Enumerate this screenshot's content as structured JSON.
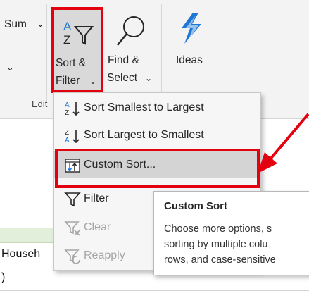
{
  "ribbon": {
    "autosum_label": "Sum",
    "sort_filter": {
      "line1": "Sort &",
      "line2": "Filter"
    },
    "find_select": {
      "line1": "Find &",
      "line2": "Select"
    },
    "ideas_label": "Ideas",
    "group_label": "Edit"
  },
  "sheet": {
    "cell_text": "Househ",
    "cell_text_2": ")",
    "header_fill": "#e2efda"
  },
  "menu": {
    "items": [
      {
        "label": "Sort Smallest to Largest",
        "icon": "sort-ascending-icon"
      },
      {
        "label": "Sort Largest to Smallest",
        "icon": "sort-descending-icon"
      },
      {
        "label": "Custom Sort...",
        "icon": "custom-sort-icon"
      },
      {
        "label": "Filter",
        "icon": "filter-icon"
      },
      {
        "label": "Clear",
        "icon": "clear-filter-icon"
      },
      {
        "label": "Reapply",
        "icon": "reapply-filter-icon"
      }
    ]
  },
  "tooltip": {
    "title": "Custom Sort",
    "body": "Choose more options, s\nsorting by multiple colu\nrows, and case-sensitive"
  },
  "colors": {
    "highlight": "#e3000f",
    "ideas_icon": "#1f77d4"
  }
}
